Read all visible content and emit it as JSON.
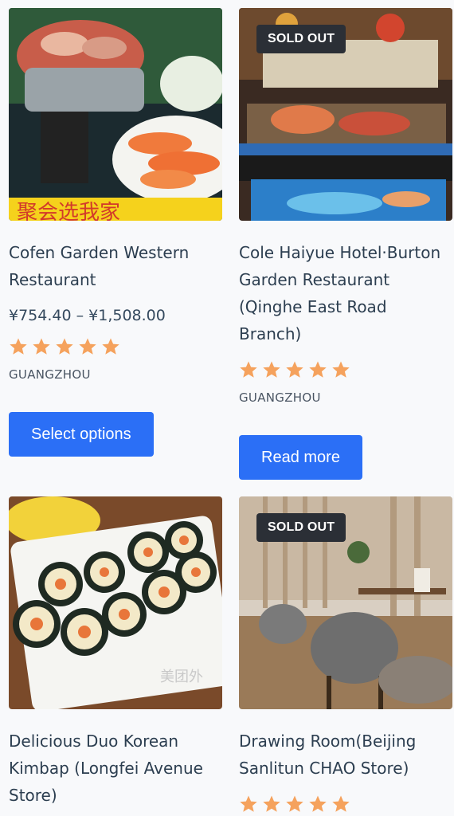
{
  "products": [
    {
      "title": "Cofen Garden Western Restaurant",
      "price": "¥754.40 – ¥1,508.00",
      "rating": 5,
      "city": "GUANGZHOU",
      "button_label": "Select options",
      "badge": "",
      "image_sign_text": "聚会选我家"
    },
    {
      "title": "Cole Haiyue Hotel·Burton Garden Restaurant (Qinghe East Road Branch)",
      "price": "",
      "rating": 5,
      "city": "GUANGZHOU",
      "button_label": "Read more",
      "badge": "SOLD OUT"
    },
    {
      "title": "Delicious Duo Korean Kimbap (Longfei Avenue Store)",
      "badge": "",
      "image_watermark": "美团外"
    },
    {
      "title": "Drawing Room(Beijing Sanlitun CHAO Store)",
      "rating": 5,
      "badge": "SOLD OUT"
    }
  ],
  "colors": {
    "accent": "#2b6ff6",
    "star": "#f5a25d",
    "badge_bg": "#2b2f36"
  },
  "icons": {
    "rating": "star-icon"
  }
}
